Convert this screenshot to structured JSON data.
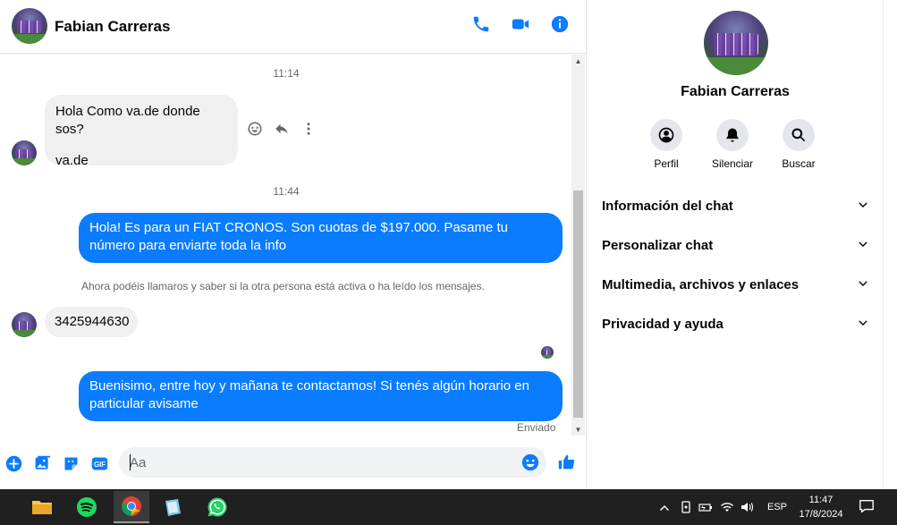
{
  "contact": {
    "name": "Fabian Carreras"
  },
  "header": {
    "icons": [
      "phone-icon",
      "video-icon",
      "info-icon"
    ]
  },
  "messages": {
    "time1": "11:14",
    "incoming1_line1": "Hola Como va.de donde sos?",
    "incoming1_line2": "va.de",
    "time2": "11:44",
    "outgoing1": "Hola! Es para un FIAT CRONOS. Son cuotas de $197.000. Pasame tu número para enviarte toda la info",
    "notice": "Ahora podéis llamaros y saber si la otra persona está activa o ha leído los mensajes.",
    "incoming2": "3425944630",
    "outgoing2": "Buenisimo, entre hoy y mañana te contactamos! Si tenés algún horario en particular avisame",
    "status": "Enviado"
  },
  "composer": {
    "placeholder": "Aa",
    "icons": [
      "plus-icon",
      "image-icon",
      "sticker-icon",
      "gif-icon",
      "emoji-icon",
      "like-icon"
    ]
  },
  "panel": {
    "actions": [
      {
        "label": "Perfil",
        "icon": "profile-icon"
      },
      {
        "label": "Silenciar",
        "icon": "bell-icon"
      },
      {
        "label": "Buscar",
        "icon": "search-icon"
      }
    ],
    "sections": [
      "Información del chat",
      "Personalizar chat",
      "Multimedia, archivos y enlaces",
      "Privacidad y ayuda"
    ]
  },
  "taskbar": {
    "apps": [
      "file-explorer-icon",
      "spotify-icon",
      "chrome-icon",
      "notepad-icon",
      "whatsapp-icon"
    ],
    "lang": "ESP",
    "time": "11:47",
    "date": "17/8/2024"
  },
  "colors": {
    "accent": "#0a7cff",
    "taskbar": "#202020",
    "bubble_in": "#f0f0f0"
  }
}
